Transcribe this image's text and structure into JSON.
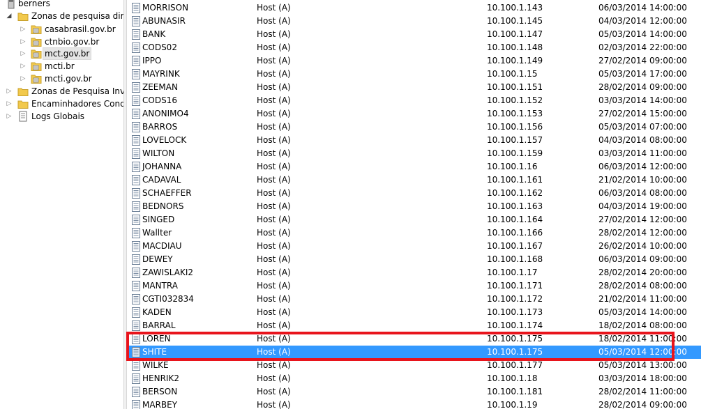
{
  "tree": {
    "server": {
      "label": "berners",
      "icon": "server-icon"
    },
    "forward_zones": {
      "label": "Zonas de pesquisa direta",
      "icon": "folder-icon"
    },
    "zones": [
      {
        "label": "casabrasil.gov.br",
        "icon": "zone-icon"
      },
      {
        "label": "ctnbio.gov.br",
        "icon": "zone-icon"
      },
      {
        "label": "mct.gov.br",
        "icon": "zone-icon",
        "selected": true
      },
      {
        "label": "mcti.br",
        "icon": "zone-icon"
      },
      {
        "label": "mcti.gov.br",
        "icon": "zone-icon"
      }
    ],
    "reverse_zones": {
      "label": "Zonas de Pesquisa Invers",
      "icon": "folder-icon"
    },
    "conditional_forwarders": {
      "label": "Encaminhadores Condic",
      "icon": "folder-icon"
    },
    "global_logs": {
      "label": "Logs Globais",
      "icon": "log-icon"
    }
  },
  "records": [
    {
      "name": "MORRISON",
      "type": "Host (A)",
      "data": "10.100.1.143",
      "timestamp": "06/03/2014 14:00:00"
    },
    {
      "name": "ABUNASIR",
      "type": "Host (A)",
      "data": "10.100.1.145",
      "timestamp": "04/03/2014 12:00:00"
    },
    {
      "name": "BANK",
      "type": "Host (A)",
      "data": "10.100.1.147",
      "timestamp": "05/03/2014 14:00:00"
    },
    {
      "name": "CODS02",
      "type": "Host (A)",
      "data": "10.100.1.148",
      "timestamp": "02/03/2014 22:00:00"
    },
    {
      "name": "IPPO",
      "type": "Host (A)",
      "data": "10.100.1.149",
      "timestamp": "27/02/2014 09:00:00"
    },
    {
      "name": "MAYRINK",
      "type": "Host (A)",
      "data": "10.100.1.15",
      "timestamp": "05/03/2014 17:00:00"
    },
    {
      "name": "ZEEMAN",
      "type": "Host (A)",
      "data": "10.100.1.151",
      "timestamp": "28/02/2014 09:00:00"
    },
    {
      "name": "CODS16",
      "type": "Host (A)",
      "data": "10.100.1.152",
      "timestamp": "03/03/2014 14:00:00"
    },
    {
      "name": "ANONIMO4",
      "type": "Host (A)",
      "data": "10.100.1.153",
      "timestamp": "27/02/2014 15:00:00"
    },
    {
      "name": "BARROS",
      "type": "Host (A)",
      "data": "10.100.1.156",
      "timestamp": "05/03/2014 07:00:00"
    },
    {
      "name": "LOVELOCK",
      "type": "Host (A)",
      "data": "10.100.1.157",
      "timestamp": "04/03/2014 08:00:00"
    },
    {
      "name": "WILTON",
      "type": "Host (A)",
      "data": "10.100.1.159",
      "timestamp": "03/03/2014 11:00:00"
    },
    {
      "name": "JOHANNA",
      "type": "Host (A)",
      "data": "10.100.1.16",
      "timestamp": "06/03/2014 12:00:00"
    },
    {
      "name": "CADAVAL",
      "type": "Host (A)",
      "data": "10.100.1.161",
      "timestamp": "21/02/2014 10:00:00"
    },
    {
      "name": "SCHAEFFER",
      "type": "Host (A)",
      "data": "10.100.1.162",
      "timestamp": "06/03/2014 08:00:00"
    },
    {
      "name": "BEDNORS",
      "type": "Host (A)",
      "data": "10.100.1.163",
      "timestamp": "04/03/2014 19:00:00"
    },
    {
      "name": "SINGED",
      "type": "Host (A)",
      "data": "10.100.1.164",
      "timestamp": "27/02/2014 12:00:00"
    },
    {
      "name": "Wallter",
      "type": "Host (A)",
      "data": "10.100.1.166",
      "timestamp": "28/02/2014 12:00:00"
    },
    {
      "name": "MACDIAU",
      "type": "Host (A)",
      "data": "10.100.1.167",
      "timestamp": "26/02/2014 10:00:00"
    },
    {
      "name": "DEWEY",
      "type": "Host (A)",
      "data": "10.100.1.168",
      "timestamp": "06/03/2014 09:00:00"
    },
    {
      "name": "ZAWISLAKI2",
      "type": "Host (A)",
      "data": "10.100.1.17",
      "timestamp": "28/02/2014 20:00:00"
    },
    {
      "name": "MANTRA",
      "type": "Host (A)",
      "data": "10.100.1.171",
      "timestamp": "28/02/2014 08:00:00"
    },
    {
      "name": "CGTI032834",
      "type": "Host (A)",
      "data": "10.100.1.172",
      "timestamp": "21/02/2014 11:00:00"
    },
    {
      "name": "KADEN",
      "type": "Host (A)",
      "data": "10.100.1.173",
      "timestamp": "05/03/2014 14:00:00"
    },
    {
      "name": "BARRAL",
      "type": "Host (A)",
      "data": "10.100.1.174",
      "timestamp": "18/02/2014 08:00:00"
    },
    {
      "name": "LOREN",
      "type": "Host (A)",
      "data": "10.100.1.175",
      "timestamp": "18/02/2014 11:00:00"
    },
    {
      "name": "SHITE",
      "type": "Host (A)",
      "data": "10.100.1.175",
      "timestamp": "05/03/2014 12:00:00",
      "selected": true
    },
    {
      "name": "WILKE",
      "type": "Host (A)",
      "data": "10.100.1.177",
      "timestamp": "05/03/2014 13:00:00"
    },
    {
      "name": "HENRIK2",
      "type": "Host (A)",
      "data": "10.100.1.18",
      "timestamp": "03/03/2014 18:00:00"
    },
    {
      "name": "BERSON",
      "type": "Host (A)",
      "data": "10.100.1.181",
      "timestamp": "28/02/2014 11:00:00"
    },
    {
      "name": "MARBEY",
      "type": "Host (A)",
      "data": "10.100.1.19",
      "timestamp": "28/02/2014 09:00:00"
    }
  ],
  "colors": {
    "selection": "#3399ff",
    "highlight_box": "#e8141c",
    "folder": "#f2c94c"
  }
}
